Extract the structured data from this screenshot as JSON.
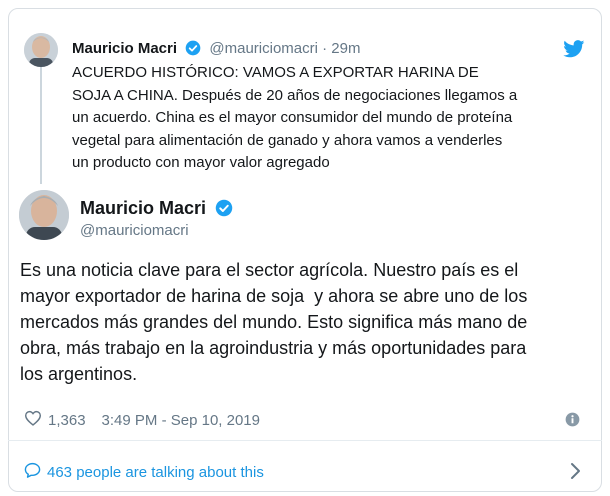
{
  "quoted_tweet": {
    "name": "Mauricio Macri",
    "handle": "@mauriciomacri",
    "separator": "·",
    "time": "29m",
    "text_lines": [
      "ACUERDO HISTÓRICO: VAMOS A EXPORTAR HARINA DE",
      "SOJA A CHINA. Después de 20 años de negociaciones llegamos a",
      "un acuerdo. China es el mayor consumidor del mundo de proteína",
      "vegetal para alimentación de ganado y ahora vamos a venderles",
      "un producto con mayor valor agregado"
    ]
  },
  "main_tweet": {
    "name": "Mauricio Macri",
    "handle": "@mauriciomacri",
    "text_lines": [
      "Es una noticia clave para el sector agrícola. Nuestro país es el",
      "mayor exportador de harina de soja  y ahora se abre uno de los",
      "mercados más grandes del mundo. Esto significa más mano de",
      "obra, más trabajo en la agroindustria y más oportunidades para",
      "los argentinos."
    ],
    "likes": "1,363",
    "timestamp": "3:49 PM - Sep 10, 2019"
  },
  "footer": {
    "talking": "463 people are talking about this"
  },
  "icons": {
    "brand": "twitter-bird-icon",
    "verified": "verified-badge-icon",
    "like": "heart-icon",
    "info": "info-icon",
    "comment": "comment-bubble-icon",
    "chevron": "chevron-right-icon"
  },
  "colors": {
    "accent": "#1da1f2",
    "link": "#1b95e0",
    "muted": "#657786"
  }
}
